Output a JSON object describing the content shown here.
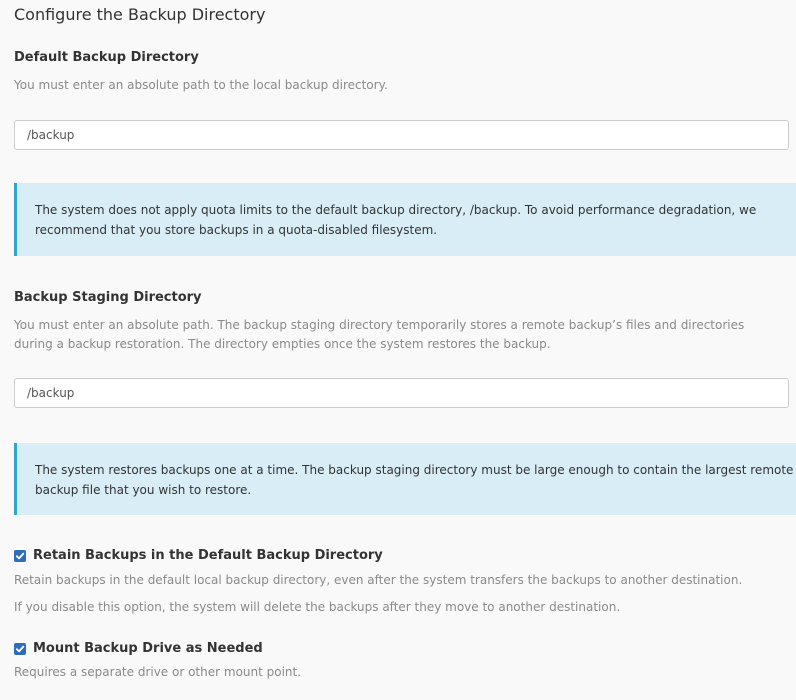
{
  "section": {
    "title": "Configure the Backup Directory"
  },
  "default_backup": {
    "label": "Default Backup Directory",
    "help": "You must enter an absolute path to the local backup directory.",
    "value": "/backup",
    "callout": "The system does not apply quota limits to the default backup directory, /backup. To avoid performance degradation, we recommend that you store backups in a quota-disabled filesystem."
  },
  "staging": {
    "label": "Backup Staging Directory",
    "help": "You must enter an absolute path. The backup staging directory temporarily stores a remote backup’s files and directories during a backup restoration. The directory empties once the system restores the backup.",
    "value": "/backup",
    "callout": "The system restores backups one at a time. The backup staging directory must be large enough to contain the largest remote backup file that you wish to restore."
  },
  "retain": {
    "checked": true,
    "label": "Retain Backups in the Default Backup Directory",
    "help1": "Retain backups in the default local backup directory, even after the system transfers the backups to another destination.",
    "help2": "If you disable this option, the system will delete the backups after they move to another destination."
  },
  "mount": {
    "checked": true,
    "label": "Mount Backup Drive as Needed",
    "help": "Requires a separate drive or other mount point."
  },
  "colors": {
    "checkbox": "#2f6cbf",
    "callout_bg": "#d9edf7",
    "callout_border": "#31a5d1"
  },
  "icons": {
    "checkbox_checked": "checkmark-icon"
  }
}
